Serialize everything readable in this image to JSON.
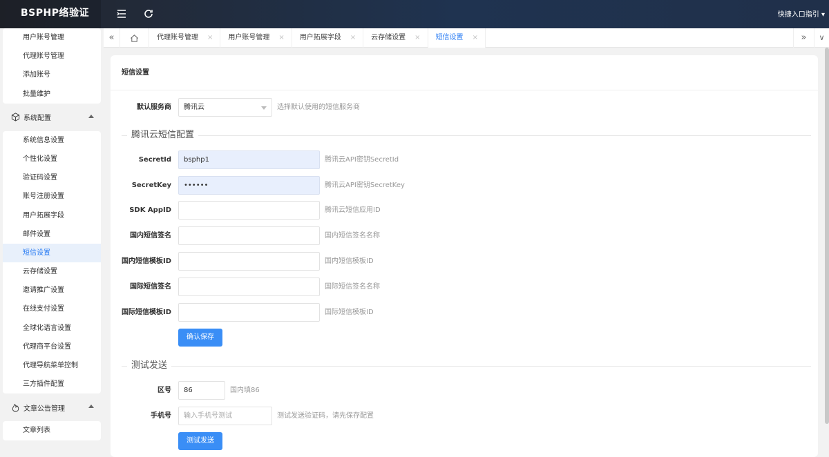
{
  "header": {
    "logo": "BSPHP络验证",
    "quick_link": "快捷入口指引 ▾"
  },
  "sidebar": {
    "group1": [
      "用户账号管理",
      "代理账号管理",
      "添加账号",
      "批量维护"
    ],
    "section_system": "系统配置",
    "group2": [
      "系统信息设置",
      "个性化设置",
      "验证码设置",
      "账号注册设置",
      "用户拓展字段",
      "邮件设置",
      "短信设置",
      "云存储设置",
      "邀请推广设置",
      "在线支付设置",
      "全球化语言设置",
      "代理商平台设置",
      "代理导航菜单控制",
      "三方插件配置"
    ],
    "section_article": "文章公告管理",
    "group3": [
      "文章列表"
    ],
    "active_item": "短信设置"
  },
  "tabs": {
    "items": [
      "代理账号管理",
      "用户账号管理",
      "用户拓展字段",
      "云存储设置",
      "短信设置"
    ],
    "close": "×",
    "active": "短信设置",
    "nav_left": "«",
    "nav_right": "»",
    "dropdown": "∨"
  },
  "card": {
    "title": "短信设置"
  },
  "form": {
    "provider": {
      "label": "默认服务商",
      "value": "腾讯云",
      "hint": "选择默认使用的短信服务商"
    },
    "section1": "腾讯云短信配置",
    "secretid": {
      "label": "SecretId",
      "value": "bsphp1",
      "hint": "腾讯云API密钥SecretId"
    },
    "secretkey": {
      "label": "SecretKey",
      "value": "••••••",
      "hint": "腾讯云API密钥SecretKey"
    },
    "appid": {
      "label": "SDK AppID",
      "value": "",
      "hint": "腾讯云短信应用ID"
    },
    "cn_sign": {
      "label": "国内短信签名",
      "value": "",
      "hint": "国内短信签名名称"
    },
    "cn_tpl": {
      "label": "国内短信模板ID",
      "value": "",
      "hint": "国内短信模板ID"
    },
    "intl_sign": {
      "label": "国际短信签名",
      "value": "",
      "hint": "国际短信签名名称"
    },
    "intl_tpl": {
      "label": "国际短信模板ID",
      "value": "",
      "hint": "国际短信模板ID"
    },
    "save_button": "确认保存",
    "section2": "测试发送",
    "area": {
      "label": "区号",
      "value": "86",
      "hint": "国内填86"
    },
    "phone": {
      "label": "手机号",
      "placeholder": "输入手机号测试",
      "hint": "测试发送验证码，请先保存配置"
    },
    "test_button": "测试发送"
  },
  "colors": {
    "topbar": "#23262e",
    "accent": "#3a8ef6",
    "active_tab": "#2a7cf3",
    "filled_input": "#e8effd"
  }
}
